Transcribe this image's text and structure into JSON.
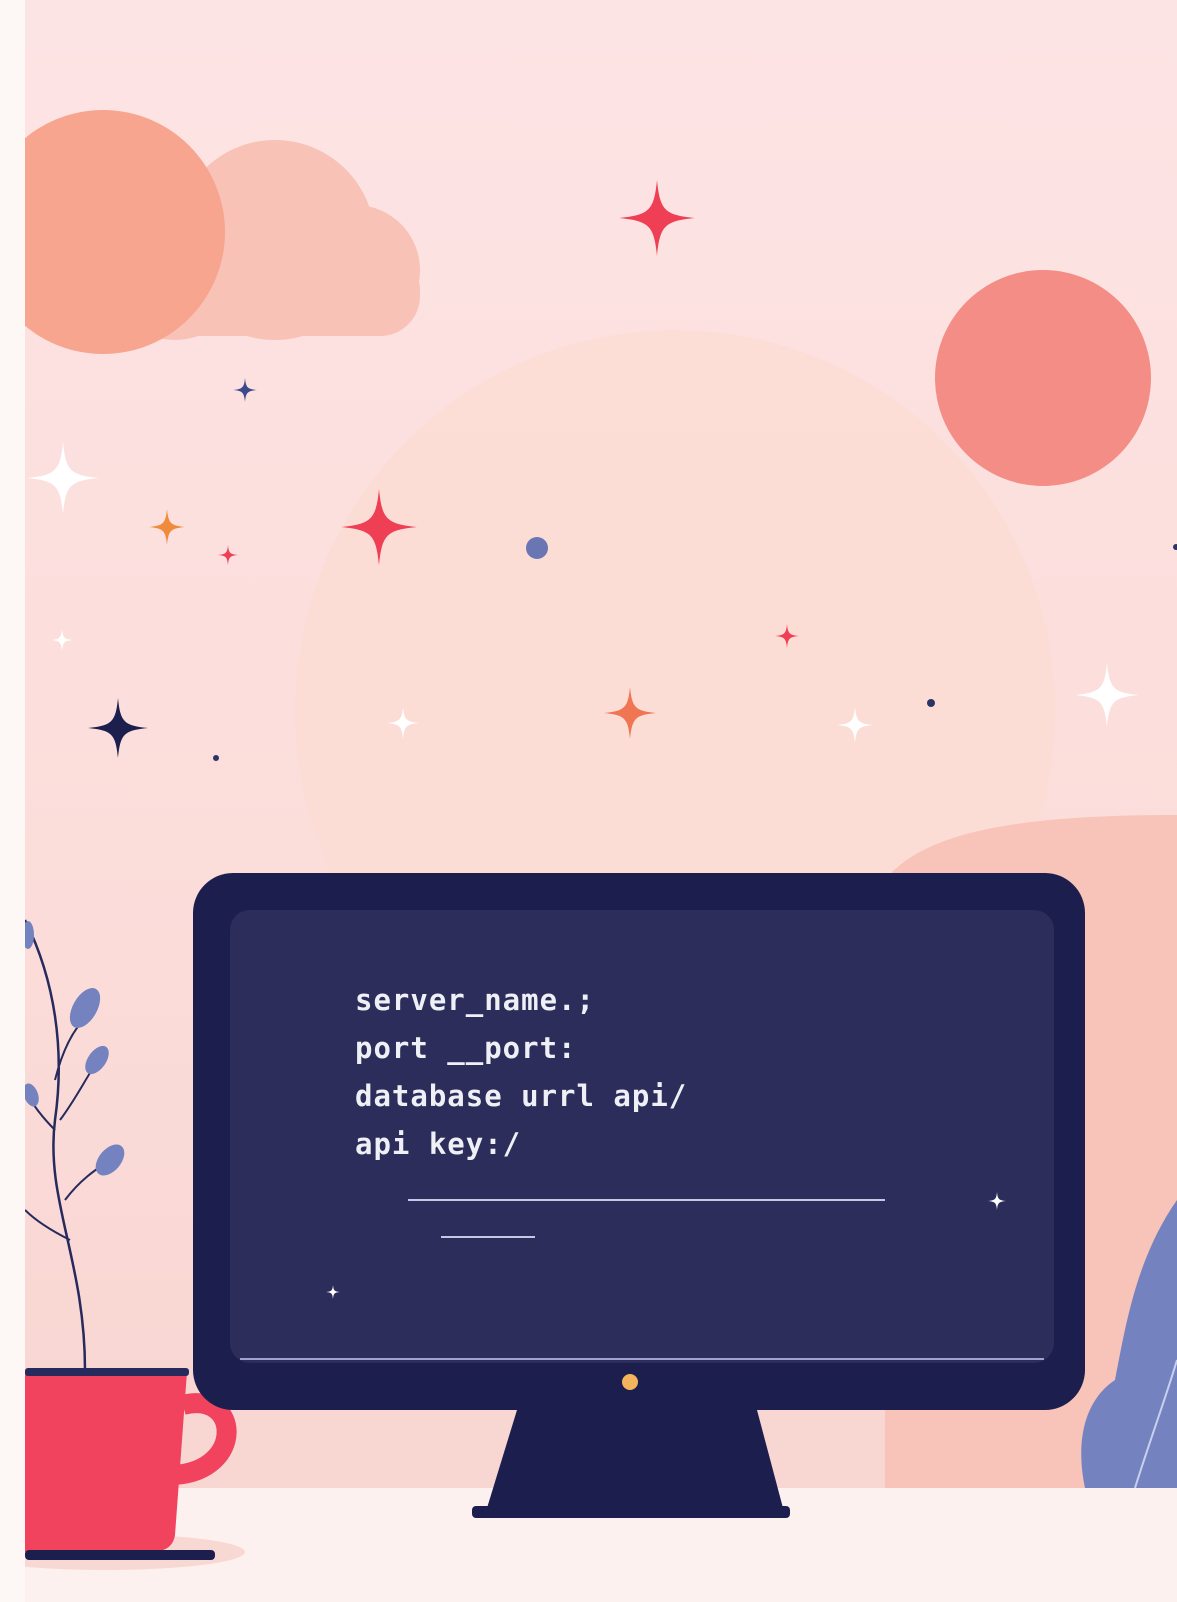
{
  "colors": {
    "background": "#fde4e4",
    "sun_left": "#f7a58f",
    "cloud": "#f8c1b6",
    "sun_right": "#f38d85",
    "big_circle": "#fcdcd3",
    "monitor_frame": "#1c1f4e",
    "monitor_screen": "#2c2d5a",
    "power_led": "#f4b45c",
    "mug": "#f1435e",
    "plant_stem": "#262a5c",
    "plant_leaf": "#7482c0",
    "desk": "#fdf1ef"
  },
  "screen": {
    "lines": [
      "server_name.;",
      "port __port:",
      "database urrl api/",
      "api key:/"
    ]
  },
  "icons": {
    "sparkle": "four-point-star",
    "dot": "circle"
  }
}
